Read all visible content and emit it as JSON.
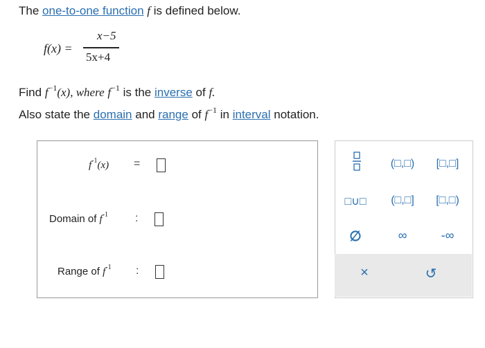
{
  "question": {
    "line1_prefix": "The",
    "line1_link": "one-to-one function",
    "line1_var": "f",
    "line1_suffix": "is defined below.",
    "function_lhs": "f(x) =",
    "numerator": "x−5",
    "denominator": "5x+4",
    "find_prefix": "Find",
    "find_var": "f",
    "find_exp": "−1",
    "find_arg": "(x), where",
    "find_var2": "f",
    "find_exp2": "−1",
    "find_mid": "is the",
    "find_link": "inverse",
    "find_of": "of",
    "find_var3": "f.",
    "state_prefix": "Also state the",
    "state_link1": "domain",
    "state_and": "and",
    "state_link2": "range",
    "state_of": "of",
    "state_var": "f",
    "state_exp": "−1",
    "state_in": "in",
    "state_link3": "interval",
    "state_suffix": "notation."
  },
  "answer": {
    "inverse_label_var": "f",
    "inverse_label_exp": "-1",
    "inverse_label_arg": "(x)",
    "equals": "=",
    "domain_label": "Domain of",
    "domain_var": "f",
    "domain_exp": "-1",
    "range_label": "Range of",
    "range_var": "f",
    "range_exp": "-1",
    "colon": ":"
  },
  "palette": {
    "open_open": "(□,□)",
    "closed_closed": "[□,□]",
    "union": "□∪□",
    "open_closed": "(□,□]",
    "closed_open": "[□,□)",
    "empty_set": "∅",
    "infinity": "∞",
    "neg_infinity": "-∞",
    "clear": "×",
    "undo": "↺"
  },
  "colors": {
    "link": "#2a6fb0",
    "panel_border": "#999999",
    "bottom_bar": "#e9e9e9"
  }
}
